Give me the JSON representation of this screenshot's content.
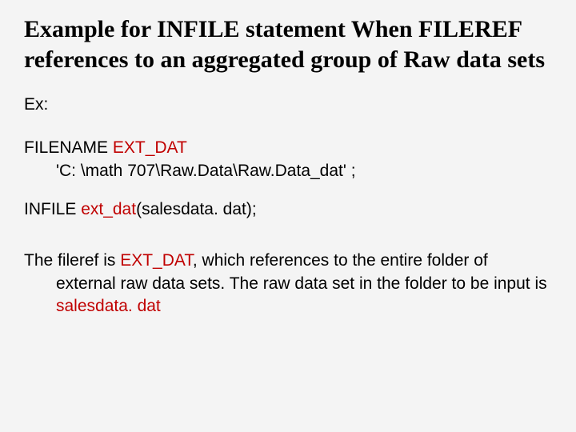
{
  "title": "Example for INFILE statement When FILEREF references to an aggregated group of Raw data sets",
  "ex_label": "Ex:",
  "code": {
    "filename_kw": "FILENAME ",
    "filename_ref": "EXT_DAT",
    "filename_path": "'C: \\math 707\\Raw.Data\\Raw.Data_dat' ;",
    "infile_kw": "INFILE  ",
    "infile_ref": "ext_dat",
    "infile_arg": "(salesdata. dat);"
  },
  "explain": {
    "p1": "The fileref is ",
    "p2": "EXT_DAT",
    "p3": ", which references to the entire folder of external raw data sets. The raw data set in the folder to be input is ",
    "p4": "salesdata. dat"
  }
}
